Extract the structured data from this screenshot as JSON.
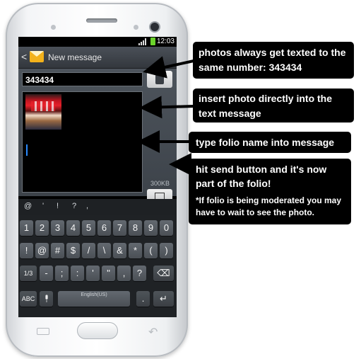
{
  "status_bar": {
    "time": "12:03"
  },
  "app_bar": {
    "back_glyph": "<",
    "title": "New message"
  },
  "compose": {
    "recipient_value": "343434",
    "message_size": "300KB",
    "attach_glyph": "📎"
  },
  "suggestions": [
    "@",
    "'",
    "!",
    "?",
    ","
  ],
  "keyboard": {
    "row1": [
      "1",
      "2",
      "3",
      "4",
      "5",
      "6",
      "7",
      "8",
      "9",
      "0"
    ],
    "row2": [
      "!",
      "@",
      "#",
      "$",
      "/",
      "\\",
      "&",
      "*",
      "(",
      ")"
    ],
    "row3": [
      "1/3",
      "-",
      ";",
      ":",
      "'",
      "\"",
      ",",
      "?"
    ],
    "row4": {
      "abc_label": "ABC",
      "space_label": "English(US)",
      "period_label": ".",
      "enter_glyph": "↵"
    },
    "delete_glyph": "⌫"
  },
  "callouts": {
    "texted": "photos always get texted to the same number: 343434",
    "insert": "insert photo directly into the text message",
    "folio": "type folio name into message",
    "send": "hit send button and it's now part of the folio!",
    "note": "*If folio is being moderated you may have to wait to see the photo."
  },
  "colors": {
    "accent": "#2b8bff",
    "battery": "#6bd32c",
    "envelope": "#f3b21b"
  }
}
